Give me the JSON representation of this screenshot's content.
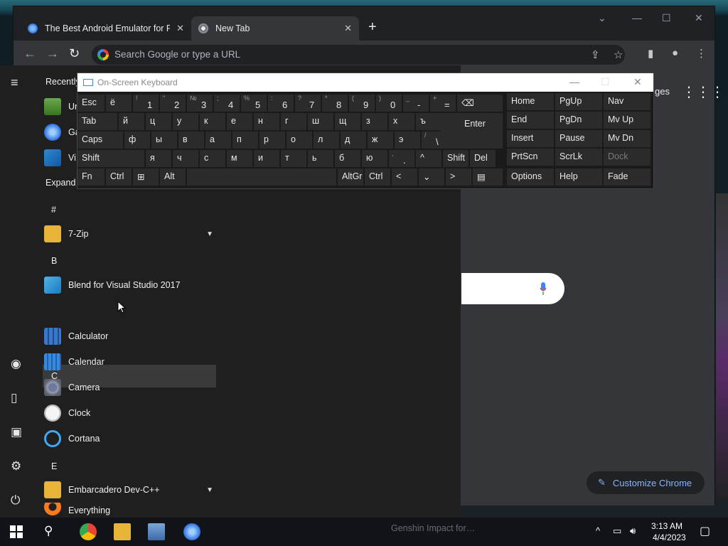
{
  "chrome": {
    "tabs": [
      {
        "title": "The Best Android Emulator for PC",
        "close": "✕"
      },
      {
        "title": "New Tab",
        "close": "✕"
      }
    ],
    "new_tab": "+",
    "window_controls": {
      "dropdown": "⌄",
      "minimize": "—",
      "maximize": "☐",
      "close": "✕"
    },
    "nav": {
      "back": "←",
      "forward": "→",
      "reload": "↻"
    },
    "omnibox_placeholder": "Search Google or type a URL",
    "images_partial": "ges",
    "customize": "Customize Chrome"
  },
  "start_menu": {
    "recently_label": "Recently",
    "recent": [
      {
        "label": "Ur"
      },
      {
        "label": "Ga"
      },
      {
        "label": "Vi"
      }
    ],
    "expand_label": "Expand",
    "hash": "#",
    "apps": {
      "seven_zip": "7-Zip",
      "letter_b": "B",
      "blend": "Blend for Visual Studio 2017",
      "letter_c": "C",
      "calculator": "Calculator",
      "calendar": "Calendar",
      "camera": "Camera",
      "clock": "Clock",
      "cortana": "Cortana",
      "letter_e": "E",
      "embarcadero": "Embarcadero Dev-C++",
      "everything": "Everything"
    }
  },
  "osk": {
    "title": "On-Screen Keyboard",
    "controls": {
      "minimize": "—",
      "maximize": "☐",
      "close": "✕"
    },
    "row1": [
      {
        "shift": "",
        "main": "Esc"
      },
      {
        "shift": "",
        "main": "ё"
      },
      {
        "shift": "!",
        "main": "1"
      },
      {
        "shift": "\"",
        "main": "2"
      },
      {
        "shift": "№",
        "main": "3"
      },
      {
        "shift": ";",
        "main": "4"
      },
      {
        "shift": "%",
        "main": "5"
      },
      {
        "shift": ":",
        "main": "6"
      },
      {
        "shift": "?",
        "main": "7"
      },
      {
        "shift": "*",
        "main": "8"
      },
      {
        "shift": "(",
        "main": "9"
      },
      {
        "shift": ")",
        "main": "0"
      },
      {
        "shift": "_",
        "main": "-"
      },
      {
        "shift": "+",
        "main": "="
      },
      {
        "shift": "",
        "main": "⌫"
      }
    ],
    "row2": [
      "Tab",
      "й",
      "ц",
      "у",
      "к",
      "е",
      "н",
      "г",
      "ш",
      "щ",
      "з",
      "х",
      "ъ"
    ],
    "row3": [
      "Caps",
      "ф",
      "ы",
      "в",
      "а",
      "п",
      "р",
      "о",
      "л",
      "д",
      "ж",
      "э"
    ],
    "row3_slash": {
      "shift": "/",
      "main": "\\"
    },
    "enter": "Enter",
    "row4": [
      "Shift",
      "я",
      "ч",
      "с",
      "м",
      "и",
      "т",
      "ь",
      "б",
      "ю"
    ],
    "row4_dot": {
      "shift": ",",
      "main": "."
    },
    "row4_up": "^",
    "row4_shift_r": "Shift",
    "row4_del": "Del",
    "row5": {
      "fn": "Fn",
      "ctrl": "Ctrl",
      "win": "⊞",
      "alt": "Alt",
      "altgr": "AltGr",
      "ctrl_r": "Ctrl",
      "left": "<",
      "down": "⌄",
      "right": ">",
      "menu": "▤"
    },
    "nav_keys": [
      [
        "Home",
        "PgUp",
        "Nav"
      ],
      [
        "End",
        "PgDn",
        "Mv Up"
      ],
      [
        "Insert",
        "Pause",
        "Mv Dn"
      ],
      [
        "PrtScn",
        "ScrLk",
        "Dock"
      ],
      [
        "Options",
        "Help",
        "Fade"
      ]
    ]
  },
  "taskbar": {
    "time": "3:13 AM",
    "date": "4/4/2023",
    "genshin": "Genshin Impact for…"
  },
  "colors": {
    "accent": "#8ab4f8",
    "chrome_bg": "#35363a",
    "start_bg": "#1f1f1f",
    "osk_key": "#2b2b2b"
  }
}
